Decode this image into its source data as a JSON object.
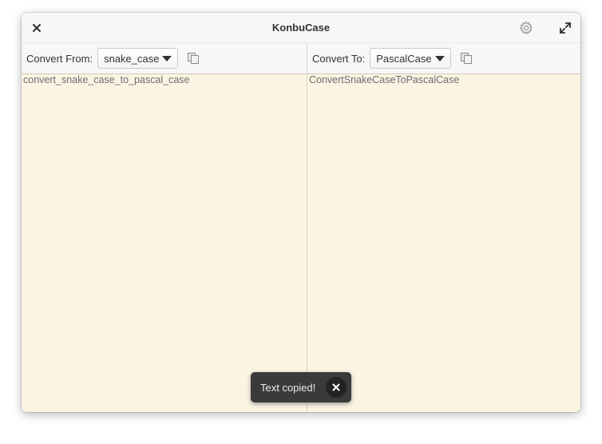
{
  "window": {
    "title": "KonbuCase"
  },
  "titlebar": {
    "close_icon": "close-icon",
    "settings_icon": "gear-icon",
    "maximize_icon": "maximize-icon"
  },
  "source": {
    "label": "Convert From:",
    "selected_case": "snake_case",
    "copy_icon": "copy-icon",
    "text": "convert_snake_case_to_pascal_case"
  },
  "target": {
    "label": "Convert To:",
    "selected_case": "PascalCase",
    "copy_icon": "copy-icon",
    "text": "ConvertSnakeCaseToPascalCase"
  },
  "toast": {
    "message": "Text copied!",
    "close_icon": "close-icon"
  },
  "colors": {
    "text_area_background": "#fbf4e3",
    "header_background": "#f7f7f7",
    "toast_background": "#3a3a3a"
  }
}
